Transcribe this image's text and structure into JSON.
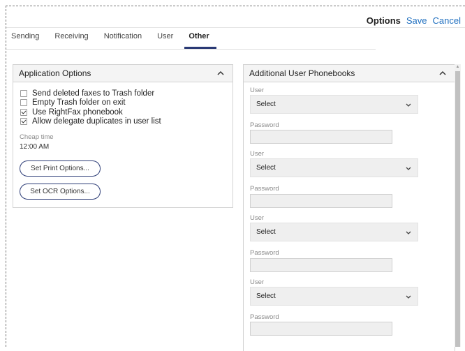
{
  "header": {
    "options_label": "Options",
    "save_label": "Save",
    "cancel_label": "Cancel"
  },
  "tabs": [
    {
      "label": "Sending"
    },
    {
      "label": "Receiving"
    },
    {
      "label": "Notification"
    },
    {
      "label": "User"
    },
    {
      "label": "Other",
      "active": true
    }
  ],
  "application_options": {
    "title": "Application Options",
    "checkboxes": [
      {
        "label": "Send deleted faxes to Trash folder",
        "checked": false
      },
      {
        "label": "Empty Trash folder on exit",
        "checked": false
      },
      {
        "label": "Use RightFax phonebook",
        "checked": true
      },
      {
        "label": "Allow delegate duplicates in user list",
        "checked": true
      }
    ],
    "cheap_time_label": "Cheap time",
    "cheap_time_value": "12:00 AM",
    "print_button_label": "Set Print Options...",
    "ocr_button_label": "Set OCR Options..."
  },
  "phonebooks": {
    "title": "Additional User Phonebooks",
    "entries": [
      {
        "user_label": "User",
        "user_value": "Select",
        "password_label": "Password",
        "password_value": ""
      },
      {
        "user_label": "User",
        "user_value": "Select",
        "password_label": "Password",
        "password_value": ""
      },
      {
        "user_label": "User",
        "user_value": "Select",
        "password_label": "Password",
        "password_value": ""
      },
      {
        "user_label": "User",
        "user_value": "Select",
        "password_label": "Password",
        "password_value": ""
      }
    ]
  },
  "icons": {
    "collapse": "chevron-up-icon",
    "dropdown": "chevron-down-icon"
  },
  "colors": {
    "accent": "#2a3a75",
    "link": "#1f6fbf"
  }
}
